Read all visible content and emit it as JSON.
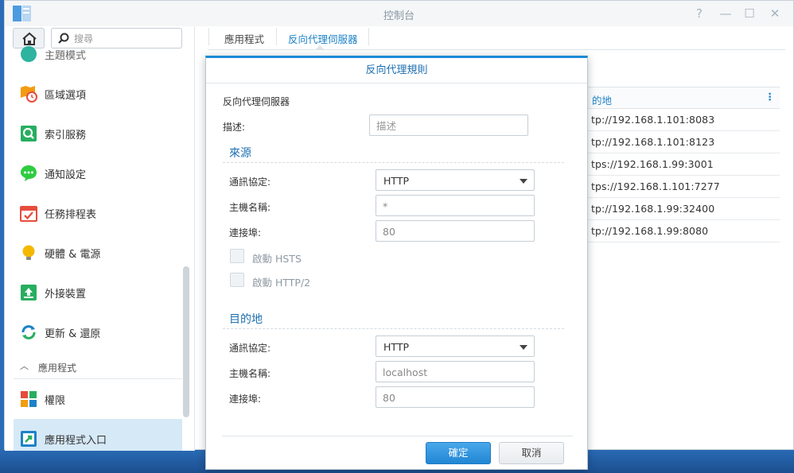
{
  "window": {
    "title": "控制台",
    "controls": {
      "help": "?",
      "minimize": "—",
      "maximize": "☐",
      "close": "✕"
    }
  },
  "sidebar": {
    "search_placeholder": "搜尋",
    "items": [
      {
        "label": "主題模式",
        "icon": "theme-icon"
      },
      {
        "label": "區域選項",
        "icon": "region-options-icon"
      },
      {
        "label": "索引服務",
        "icon": "indexing-service-icon"
      },
      {
        "label": "通知設定",
        "icon": "notification-icon"
      },
      {
        "label": "任務排程表",
        "icon": "task-scheduler-icon"
      },
      {
        "label": "硬體 & 電源",
        "icon": "hardware-power-icon"
      },
      {
        "label": "外接裝置",
        "icon": "external-devices-icon"
      },
      {
        "label": "更新 & 還原",
        "icon": "update-restore-icon"
      }
    ],
    "section": {
      "label": "應用程式"
    },
    "section_items": [
      {
        "label": "權限",
        "icon": "privileges-icon"
      },
      {
        "label": "應用程式入口",
        "icon": "application-portal-icon"
      }
    ]
  },
  "tabs": [
    {
      "label": "應用程式"
    },
    {
      "label": "反向代理伺服器"
    }
  ],
  "background_table": {
    "header": "的地",
    "more": "⋮",
    "rows": [
      "tp://192.168.1.101:8083",
      "tp://192.168.1.101:8123",
      "tps://192.168.1.99:3001",
      "tps://192.168.1.101:7277",
      "tp://192.168.1.99:32400",
      "tp://192.168.1.99:8080"
    ]
  },
  "dialog": {
    "title": "反向代理規則",
    "subheading": "反向代理伺服器",
    "description_label": "描述:",
    "description_placeholder": "描述",
    "source": {
      "title": "來源",
      "protocol_label": "通訊協定:",
      "protocol_value": "HTTP",
      "hostname_label": "主機名稱:",
      "hostname_value": "*",
      "port_label": "連接埠:",
      "port_value": "80",
      "hsts_label": "啟動 HSTS",
      "http2_label": "啟動 HTTP/2"
    },
    "destination": {
      "title": "目的地",
      "protocol_label": "通訊協定:",
      "protocol_value": "HTTP",
      "hostname_label": "主機名稱:",
      "hostname_value": "localhost",
      "port_label": "連接埠:",
      "port_value": "80"
    },
    "ok_label": "確定",
    "cancel_label": "取消"
  },
  "colors": {
    "accent": "#1d82c7",
    "primary_button": "#2186d4",
    "active_nav": "#d6e9f7"
  }
}
